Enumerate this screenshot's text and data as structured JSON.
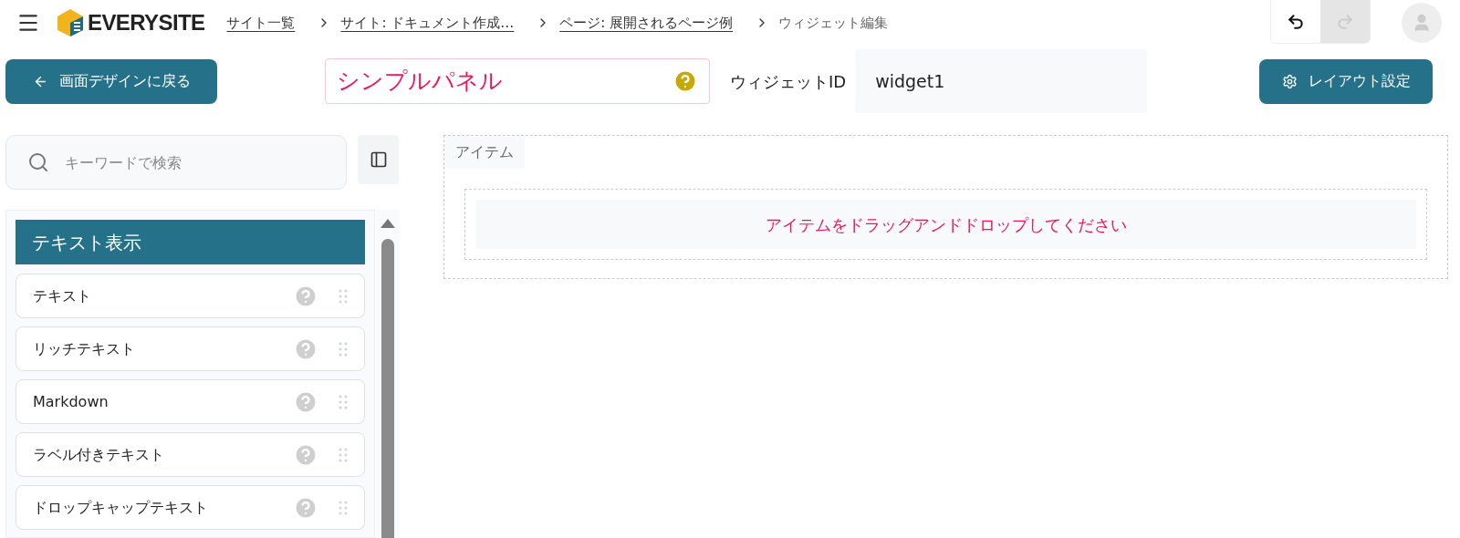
{
  "header": {
    "logo_text": "EVERYSITE",
    "breadcrumbs": [
      {
        "label": "サイト一覧",
        "kind": "link"
      },
      {
        "label": "サイト: ドキュメント作成…",
        "kind": "link"
      },
      {
        "label": "ページ: 展開されるページ例",
        "kind": "link"
      },
      {
        "label": "ウィジェット編集",
        "kind": "current"
      }
    ],
    "history_buttons": [
      {
        "kind": "undo",
        "disabled": false
      },
      {
        "kind": "redo",
        "disabled": true
      }
    ]
  },
  "toolbar": {
    "back_button": "画面デザインに戻る",
    "widget_title": "シンプルパネル",
    "widget_id_label": "ウィジェットID",
    "widget_id": "widget1",
    "layout_button": "レイアウト設定"
  },
  "sidebar": {
    "search": {
      "placeholder": "キーワードで検索"
    },
    "category": "テキスト表示",
    "items": [
      {
        "label": "テキスト"
      },
      {
        "label": "リッチテキスト"
      },
      {
        "label": "Markdown"
      },
      {
        "label": "ラベル付きテキスト"
      },
      {
        "label": "ドロップキャップテキスト"
      }
    ]
  },
  "canvas": {
    "section_label": "アイテム",
    "drop_hint": "アイテムをドラッグアンドドロップしてください"
  }
}
